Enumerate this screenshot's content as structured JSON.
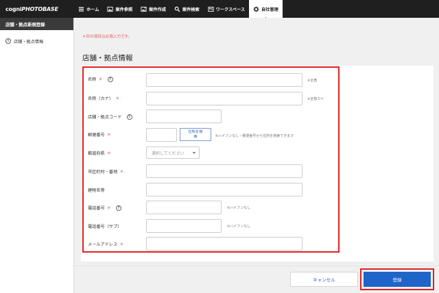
{
  "app": {
    "logo_bold": "cogni",
    "logo_italic": "PHOTOBASE"
  },
  "nav": {
    "items": [
      {
        "label": "ホーム",
        "icon": "list-icon"
      },
      {
        "label": "案件参照",
        "icon": "image-icon"
      },
      {
        "label": "案件作成",
        "icon": "image-plus-icon"
      },
      {
        "label": "案件検索",
        "icon": "search-icon"
      },
      {
        "label": "ワークスペース",
        "icon": "workspace-icon"
      },
      {
        "label": "自社管理",
        "icon": "gear-icon",
        "active": true
      }
    ]
  },
  "sidebar": {
    "header": "店舗・拠点新規登録",
    "items": [
      {
        "label": "店舗・拠点情報",
        "icon": "info-icon"
      }
    ]
  },
  "main": {
    "required_note": "＊印の項目は必須入力です。",
    "title": "店舗・拠点情報"
  },
  "form": {
    "name": {
      "label": "名称",
      "required": "＊",
      "hint": "※全角"
    },
    "name_kana": {
      "label": "名称（カナ）",
      "required": "＊",
      "hint": "※全角カナ"
    },
    "store_code": {
      "label": "店舗・拠点コード"
    },
    "postal": {
      "label": "郵便番号",
      "required": "＊",
      "button_line1": "住所を検",
      "button_line2": "索",
      "hint": "※ハイフンなし・郵便番号から住所を検索できます"
    },
    "prefecture": {
      "label": "都道府県",
      "required": "＊",
      "placeholder": "選択してください"
    },
    "city": {
      "label": "市区町村・番地",
      "required": "＊"
    },
    "building": {
      "label": "建物名等"
    },
    "phone": {
      "label": "電話番号",
      "required": "＊",
      "hint": "※ハイフンなし"
    },
    "phone_sub": {
      "label": "電話番号（サブ）",
      "hint": "※ハイフンなし"
    },
    "email": {
      "label": "メールアドレス",
      "required": "＊"
    }
  },
  "actions": {
    "cancel": "キャンセル",
    "submit": "登録"
  },
  "colors": {
    "accent": "#1f64c8",
    "highlight": "#e02020",
    "required": "#e05a5a",
    "topbar": "#1f1f1f"
  }
}
